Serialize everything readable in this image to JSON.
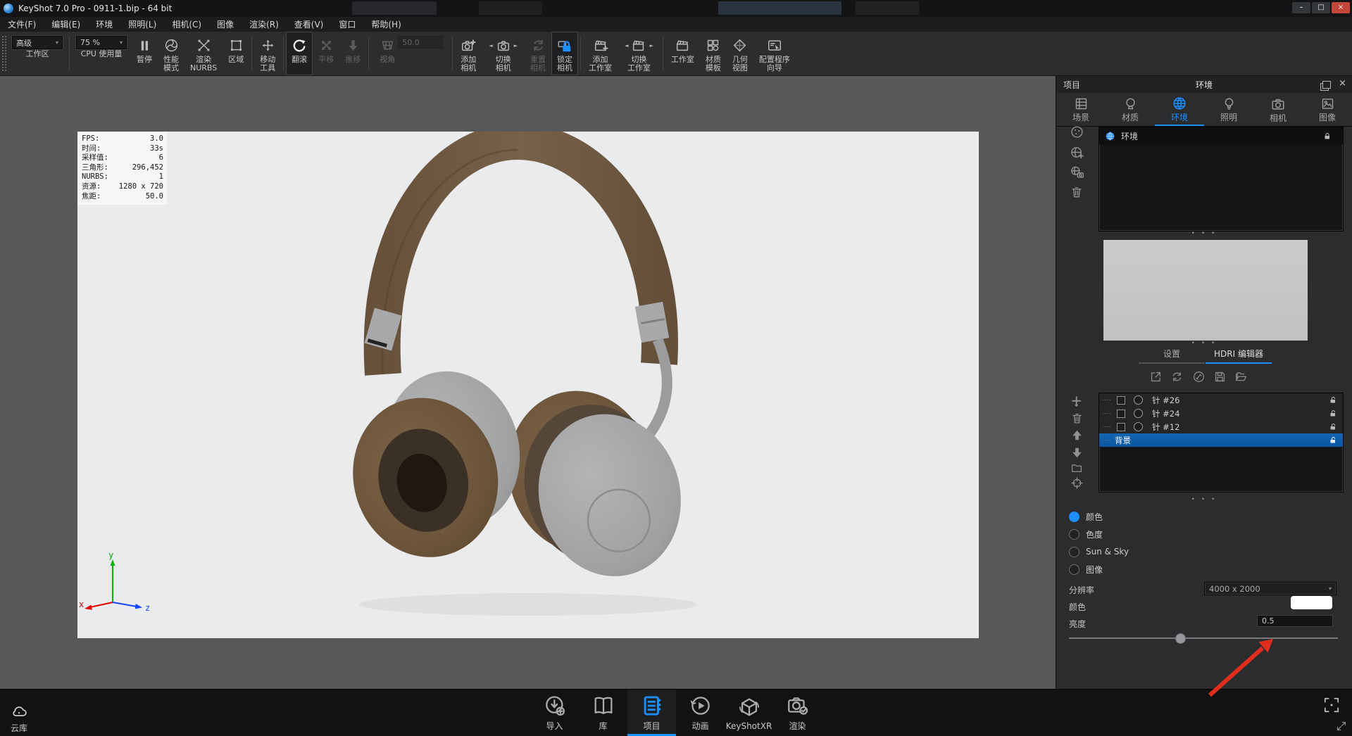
{
  "colors": {
    "accent": "#1e8fff",
    "selection_blue": "#0d55a0",
    "annotation_red": "#df2e1d",
    "color_swatch": "#ffffff",
    "viewport_bg": "#eaebed"
  },
  "glyphs": {
    "dropdown": "▾",
    "prev": "◄",
    "next": "►",
    "dots": "• • •",
    "min": "–",
    "max": "□",
    "close": "×"
  },
  "window": {
    "title": "KeyShot 7.0 Pro  - 0911-1.bip  - 64 bit"
  },
  "menu": [
    "文件(F)",
    "编辑(E)",
    "环境",
    "照明(L)",
    "相机(C)",
    "图像",
    "渲染(R)",
    "查看(V)",
    "窗口",
    "帮助(H)"
  ],
  "toolbar": {
    "workspace_value": "高级",
    "workspace_label": "工作区",
    "cpu_value": "75 %",
    "cpu_label": "CPU 使用量",
    "pause": "暂停",
    "performance": "性能\n模式",
    "nurbs": "渲染\nNURBS",
    "region": "区域",
    "move": "移动\n工具",
    "tumble": "翻滚",
    "pan": "平移",
    "dolly": "推移",
    "fov": "视角",
    "fov_value": "50.0",
    "add_camera": "添加\n相机",
    "switch_camera": "切换\n相机",
    "reset_camera": "重置\n相机",
    "lock_camera": "锁定\n相机",
    "add_studio": "添加\n工作室",
    "switch_studio": "切换\n工作室",
    "studios": "工作室",
    "material_template": "材质\n模板",
    "geometry_view": "几何\n视图",
    "wizard": "配置程序\n向导"
  },
  "stats": {
    "rows": [
      {
        "label": "FPS:",
        "value": "3.0"
      },
      {
        "label": "时间:",
        "value": "33s"
      },
      {
        "label": "采样值:",
        "value": "6"
      },
      {
        "label": "三角形:",
        "value": "296,452"
      },
      {
        "label": "NURBS:",
        "value": "1"
      },
      {
        "label": "资源:",
        "value": "1280 x 720"
      },
      {
        "label": "焦距:",
        "value": "50.0"
      }
    ]
  },
  "axis": {
    "x": "x",
    "y": "y",
    "z": "z"
  },
  "panel": {
    "dock_title": "项目",
    "title": "环境",
    "tabs": [
      "场景",
      "材质",
      "环境",
      "照明",
      "相机",
      "图像"
    ],
    "active_tab": "环境",
    "env_item": "环境",
    "sub_tabs": [
      "设置",
      "HDRI 编辑器"
    ],
    "active_sub_tab": "HDRI 编辑器",
    "pins": [
      "针 #26",
      "针 #24",
      "针 #12"
    ],
    "background_item": "背景",
    "radios": [
      "颜色",
      "色度",
      "Sun & Sky",
      "图像"
    ],
    "selected_radio": "颜色",
    "resolution_label": "分辨率",
    "resolution_value": "4000 x 2000",
    "color_label": "颜色",
    "brightness_label": "亮度",
    "brightness_value": "0.5"
  },
  "bottom": {
    "cloud": "云库",
    "items": [
      "导入",
      "库",
      "项目",
      "动画",
      "KeyShotXR",
      "渲染"
    ],
    "active_item": "项目"
  }
}
